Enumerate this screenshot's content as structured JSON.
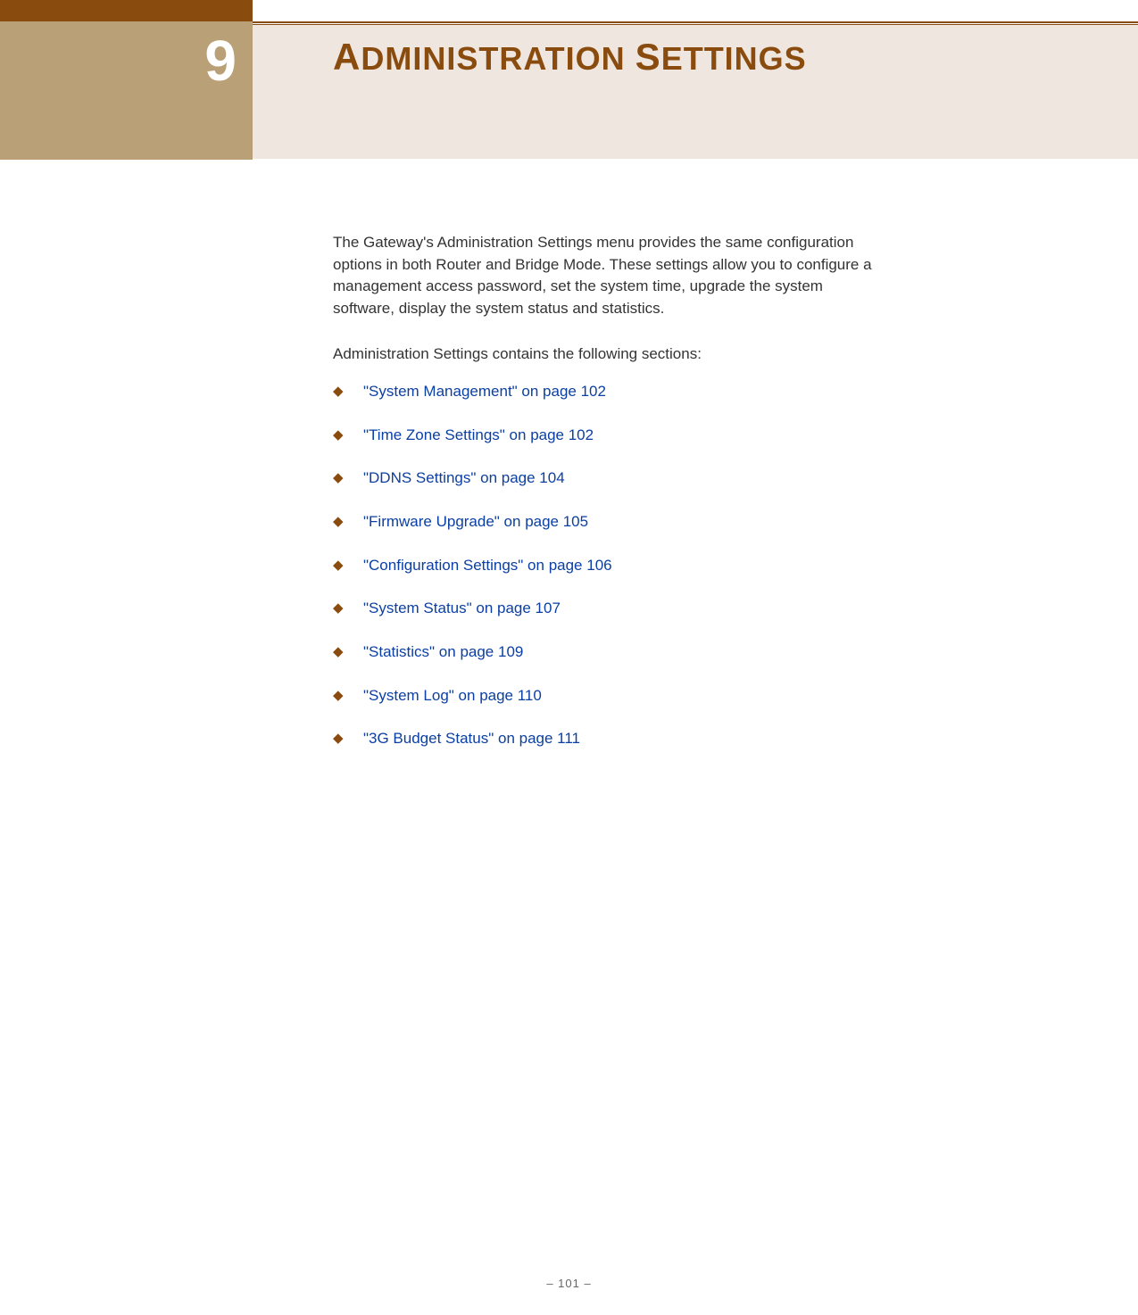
{
  "chapter": {
    "number": "9",
    "title_cap1": "A",
    "title_word1": "DMINISTRATION",
    "title_cap2": "S",
    "title_word2": "ETTINGS"
  },
  "intro": "The Gateway's Administration Settings menu provides the same configuration options in both Router and Bridge Mode. These settings allow you to configure a management access password, set the system time, upgrade the system software, display the system status and statistics.",
  "sections_heading": "Administration Settings contains the following sections:",
  "links": [
    {
      "text": "\"System Management\" on page 102"
    },
    {
      "text": "\"Time Zone Settings\" on page 102"
    },
    {
      "text": "\"DDNS Settings\" on page 104"
    },
    {
      "text": "\"Firmware Upgrade\" on page 105"
    },
    {
      "text": "\"Configuration Settings\" on page 106"
    },
    {
      "text": "\"System Status\" on page 107"
    },
    {
      "text": "\"Statistics\" on page 109"
    },
    {
      "text": "\"System Log\" on page 110"
    },
    {
      "text": "\"3G Budget Status\" on page 111"
    }
  ],
  "footer": "–  101  –"
}
